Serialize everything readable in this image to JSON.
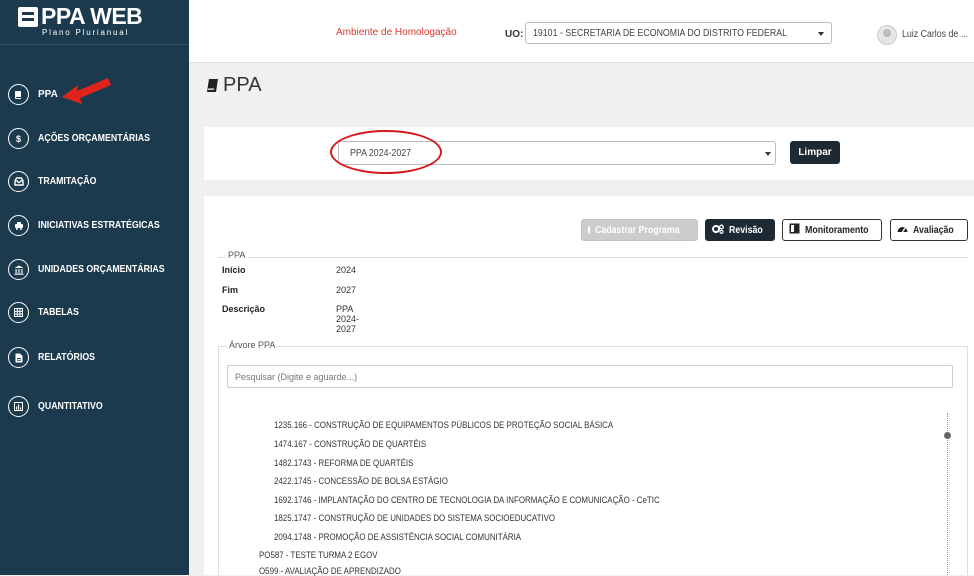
{
  "app": {
    "logo_title": "PPA WEB",
    "logo_subtitle": "Plano Plurianual"
  },
  "sidebar": {
    "items": [
      {
        "label": "PPA",
        "icon": "book-icon"
      },
      {
        "label": "AÇÕES ORÇAMENTÁRIAS",
        "icon": "dollar-icon"
      },
      {
        "label": "TRAMITAÇÃO",
        "icon": "inbox-icon"
      },
      {
        "label": "INICIATIVAS ESTRATÉGICAS",
        "icon": "taxi-icon"
      },
      {
        "label": "UNIDADES ORÇAMENTÁRIAS",
        "icon": "institution-icon"
      },
      {
        "label": "TABELAS",
        "icon": "table-icon"
      },
      {
        "label": "RELATÓRIOS",
        "icon": "file-icon"
      },
      {
        "label": "QUANTITATIVO",
        "icon": "bar-chart-icon"
      }
    ]
  },
  "header": {
    "environment": "Ambiente de Homologação",
    "uo_label": "UO:",
    "uo_value": "19101 - SECRETARIA DE ECONOMIA DO DISTRITO FEDERAL",
    "user_name": "Luiz Carlos de ..."
  },
  "page": {
    "title": "PPA"
  },
  "filter": {
    "ppa_selected": "PPA 2024-2027",
    "clear_label": "Limpar"
  },
  "actions": {
    "cadastrar": "Cadastrar Programa",
    "revisao": "Revisão",
    "monitoramento": "Monitoramento",
    "avaliacao": "Avaliação"
  },
  "ppa_info": {
    "legend": "PPA",
    "rows": [
      {
        "key": "Início",
        "value": "2024"
      },
      {
        "key": "Fim",
        "value": "2027"
      },
      {
        "key": "Descrição",
        "value": "PPA 2024-2027"
      }
    ]
  },
  "tree": {
    "legend": "Árvore PPA",
    "search_placeholder": "Pesquisar (Digite e aguarde...)",
    "nodes": [
      "1235.166 - CONSTRUÇÃO DE EQUIPAMENTOS PÚBLICOS DE PROTEÇÃO SOCIAL BÁSICA",
      "1474.167 - CONSTRUÇÃO DE QUARTÉIS",
      "1482.1743 - REFORMA DE QUARTÉIS",
      "2422.1745 - CONCESSÃO DE BOLSA ESTÁGIO",
      "1692.1746 - IMPLANTAÇÃO DO CENTRO DE TECNOLOGIA DA INFORMAÇÃO E COMUNICAÇÃO - CeTIC",
      "1825.1747 - CONSTRUÇÃO DE UNIDADES DO SISTEMA SOCIOEDUCATIVO",
      "2094.1748 - PROMOÇÃO DE ASSISTÊNCIA SOCIAL COMUNITÁRIA",
      "PO587 - TESTE TURMA 2 EGOV",
      "O599 - AVALIAÇÃO DE APRENDIZADO"
    ]
  },
  "colors": {
    "sidebar": "#1c3a4d",
    "accent_red": "#d4191e",
    "dark_button": "#1e2a33"
  }
}
